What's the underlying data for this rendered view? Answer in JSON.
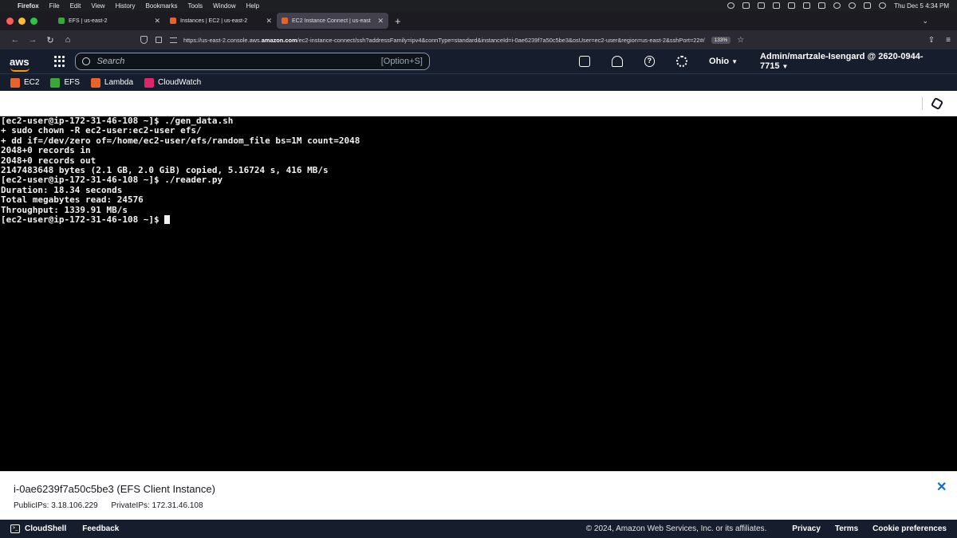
{
  "mac_menu": {
    "app": "Firefox",
    "items": [
      "File",
      "Edit",
      "View",
      "History",
      "Bookmarks",
      "Tools",
      "Window",
      "Help"
    ],
    "datetime": "Thu Dec 5  4:34 PM"
  },
  "browser": {
    "tabs": [
      {
        "label": "EFS | us-east-2",
        "favicon_color": "#3aa736"
      },
      {
        "label": "Instances | EC2 | us-east-2",
        "favicon_color": "#e8622c"
      },
      {
        "label": "EC2 Instance Connect | us-east",
        "favicon_color": "#e8622c",
        "active": true
      }
    ],
    "url_prefix": "https://us-east-2.console.aws.",
    "url_domain": "amazon.com",
    "url_suffix": "/ec2-instance-connect/ssh?addressFamily=ipv4&connType=standard&instanceId=i-0ae6239f7a50c5be3&osUser=ec2-user&region=us-east-2&sshPort=22#/",
    "zoom": "133%"
  },
  "aws_header": {
    "logo": "aws",
    "search_placeholder": "Search",
    "search_shortcut": "[Option+S]",
    "region": "Ohio",
    "account": "Admin/martzale-Isengard @ 2620-0944-7715",
    "help_glyph": "?"
  },
  "favorites": [
    {
      "label": "EC2",
      "color": "#e8622c"
    },
    {
      "label": "EFS",
      "color": "#3aa736"
    },
    {
      "label": "Lambda",
      "color": "#e8622c"
    },
    {
      "label": "CloudWatch",
      "color": "#e0246a"
    }
  ],
  "terminal": {
    "lines": [
      "[ec2-user@ip-172-31-46-108 ~]$ ./gen_data.sh",
      "+ sudo chown -R ec2-user:ec2-user efs/",
      "+ dd if=/dev/zero of=/home/ec2-user/efs/random_file bs=1M count=2048",
      "2048+0 records in",
      "2048+0 records out",
      "2147483648 bytes (2.1 GB, 2.0 GiB) copied, 5.16724 s, 416 MB/s",
      "[ec2-user@ip-172-31-46-108 ~]$ ./reader.py",
      "Duration: 18.34 seconds",
      "Total megabytes read: 24576",
      "Throughput: 1339.91 MB/s"
    ],
    "prompt": "[ec2-user@ip-172-31-46-108 ~]$ "
  },
  "instance": {
    "title": "i-0ae6239f7a50c5be3 (EFS Client Instance)",
    "public_ips": "PublicIPs: 3.18.106.229",
    "private_ips": "PrivateIPs: 172.31.46.108"
  },
  "footer": {
    "cloudshell": "CloudShell",
    "feedback": "Feedback",
    "copyright": "© 2024, Amazon Web Services, Inc. or its affiliates.",
    "privacy": "Privacy",
    "terms": "Terms",
    "cookie": "Cookie preferences"
  }
}
